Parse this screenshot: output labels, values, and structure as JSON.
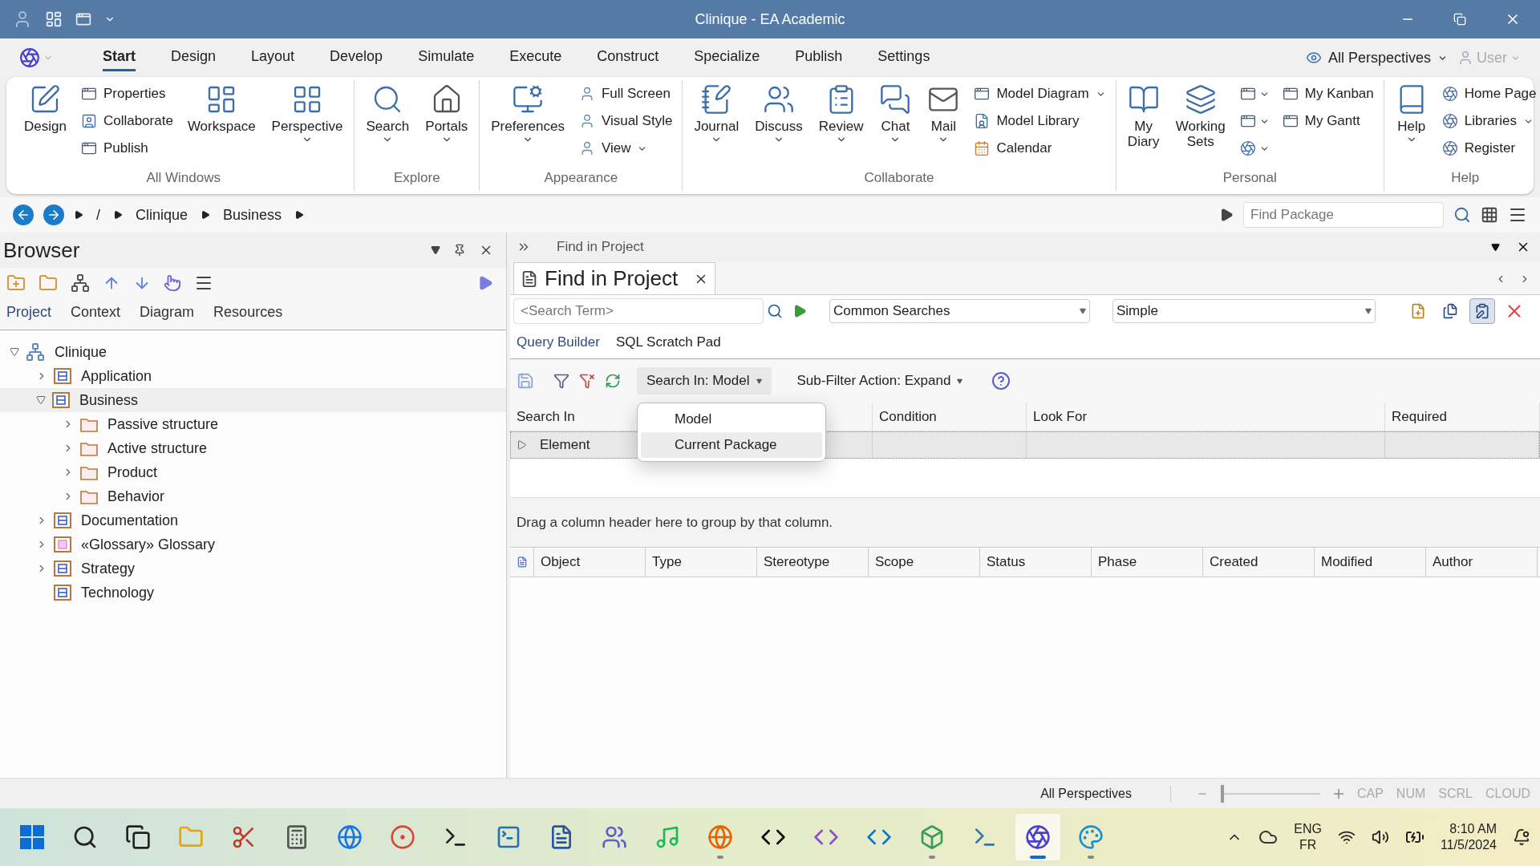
{
  "window": {
    "title": "Clinique - EA Academic"
  },
  "menu_tabs": [
    {
      "label": "Start",
      "selected": true
    },
    {
      "label": "Design",
      "selected": false
    },
    {
      "label": "Layout",
      "selected": false
    },
    {
      "label": "Develop",
      "selected": false
    },
    {
      "label": "Simulate",
      "selected": false
    },
    {
      "label": "Execute",
      "selected": false
    },
    {
      "label": "Construct",
      "selected": false
    },
    {
      "label": "Specialize",
      "selected": false
    },
    {
      "label": "Publish",
      "selected": false
    },
    {
      "label": "Settings",
      "selected": false
    }
  ],
  "perspective_menu": "All Perspectives",
  "user_menu": "User",
  "ribbon": [
    {
      "label": "All Windows",
      "items": [
        {
          "kind": "large",
          "label": "Design",
          "dropdown": false
        },
        {
          "kind": "small",
          "label": "Properties",
          "dropdown": false
        },
        {
          "kind": "small",
          "label": "Collaborate",
          "dropdown": false
        },
        {
          "kind": "small",
          "label": "Publish",
          "dropdown": false
        },
        {
          "kind": "large",
          "label": "Workspace",
          "dropdown": false
        },
        {
          "kind": "large",
          "label": "Perspective",
          "dropdown": true
        }
      ]
    },
    {
      "label": "Explore",
      "items": [
        {
          "kind": "large",
          "label": "Search",
          "dropdown": true
        },
        {
          "kind": "large",
          "label": "Portals",
          "dropdown": true
        }
      ]
    },
    {
      "label": "Appearance",
      "items": [
        {
          "kind": "large",
          "label": "Preferences",
          "dropdown": true
        },
        {
          "kind": "small",
          "label": "Full Screen",
          "dropdown": false
        },
        {
          "kind": "small",
          "label": "Visual Style",
          "dropdown": false
        },
        {
          "kind": "small",
          "label": "View",
          "dropdown": true
        }
      ]
    },
    {
      "label": "Collaborate",
      "items": [
        {
          "kind": "large",
          "label": "Journal",
          "dropdown": true
        },
        {
          "kind": "large",
          "label": "Discuss",
          "dropdown": true
        },
        {
          "kind": "large",
          "label": "Review",
          "dropdown": true
        },
        {
          "kind": "large",
          "label": "Chat",
          "dropdown": true
        },
        {
          "kind": "large",
          "label": "Mail",
          "dropdown": true
        },
        {
          "kind": "small",
          "label": "Model Diagram",
          "dropdown": true
        },
        {
          "kind": "small",
          "label": "Model Library",
          "dropdown": false
        },
        {
          "kind": "small",
          "label": "Calendar",
          "dropdown": false
        }
      ]
    },
    {
      "label": "Personal",
      "items": [
        {
          "kind": "large",
          "label": "My Diary",
          "dropdown": false
        },
        {
          "kind": "large",
          "label": "Working Sets",
          "dropdown": false
        },
        {
          "kind": "icon",
          "dropdown": true
        },
        {
          "kind": "icon",
          "dropdown": true
        },
        {
          "kind": "icon",
          "dropdown": true
        },
        {
          "kind": "small",
          "label": "My Kanban",
          "dropdown": false
        },
        {
          "kind": "small",
          "label": "My Gantt",
          "dropdown": false
        }
      ]
    },
    {
      "label": "Help",
      "items": [
        {
          "kind": "large",
          "label": "Help",
          "dropdown": true
        },
        {
          "kind": "small",
          "label": "Home Page",
          "dropdown": false
        },
        {
          "kind": "small",
          "label": "Libraries",
          "dropdown": true
        },
        {
          "kind": "small",
          "label": "Register",
          "dropdown": false
        }
      ]
    }
  ],
  "breadcrumb": [
    "/",
    "Clinique",
    "Business"
  ],
  "find_package": {
    "placeholder": "Find Package"
  },
  "browser": {
    "title": "Browser",
    "tabs": [
      {
        "label": "Project",
        "selected": true
      },
      {
        "label": "Context",
        "selected": false
      },
      {
        "label": "Diagram",
        "selected": false
      },
      {
        "label": "Resources",
        "selected": false
      }
    ],
    "tree": [
      {
        "label": "Clinique",
        "kind": "model",
        "expandable": true,
        "expanded": true,
        "selected": false,
        "children": [
          {
            "label": "Application",
            "kind": "package",
            "expandable": true,
            "expanded": false,
            "selected": false
          },
          {
            "label": "Business",
            "kind": "package",
            "expandable": true,
            "expanded": true,
            "selected": true,
            "children": [
              {
                "label": "Passive structure",
                "kind": "folder",
                "expandable": true,
                "expanded": false,
                "selected": false
              },
              {
                "label": "Active structure",
                "kind": "folder",
                "expandable": true,
                "expanded": false,
                "selected": false
              },
              {
                "label": "Product",
                "kind": "folder",
                "expandable": true,
                "expanded": false,
                "selected": false
              },
              {
                "label": "Behavior",
                "kind": "folder",
                "expandable": true,
                "expanded": false,
                "selected": false
              }
            ]
          },
          {
            "label": "Documentation",
            "kind": "package",
            "expandable": true,
            "expanded": false,
            "selected": false
          },
          {
            "label": "«Glossary» Glossary",
            "kind": "glossary",
            "expandable": true,
            "expanded": false,
            "selected": false
          },
          {
            "label": "Strategy",
            "kind": "package",
            "expandable": true,
            "expanded": false,
            "selected": false
          },
          {
            "label": "Technology",
            "kind": "package",
            "expandable": false,
            "expanded": false,
            "selected": false
          }
        ]
      }
    ]
  },
  "find": {
    "panel_title": "Find in Project",
    "tab_title": "Find in Project",
    "search": {
      "placeholder": "<Search Term>"
    },
    "combos": [
      "Common Searches",
      "Simple"
    ],
    "tool_buttons": [
      {
        "pressed": false
      },
      {
        "pressed": false
      },
      {
        "pressed": true
      },
      {
        "pressed": false
      }
    ],
    "subtabs": [
      {
        "label": "Query Builder",
        "selected": true
      },
      {
        "label": "SQL Scratch Pad",
        "selected": false
      }
    ],
    "search_in_button": "Search In: Model",
    "subfilter_button": "Sub-Filter Action: Expand",
    "search_in_menu": [
      {
        "label": "Model",
        "selected": false
      },
      {
        "label": "Current Package",
        "selected": true
      }
    ],
    "query_columns": [
      "Search In",
      "Condition",
      "Look For",
      "Required"
    ],
    "query_rows": [
      {
        "cells": [
          "Element",
          "",
          "",
          ""
        ]
      }
    ],
    "group_hint": "Drag a column header here to group by that column.",
    "result_columns": [
      "Object",
      "Type",
      "Stereotype",
      "Scope",
      "Status",
      "Phase",
      "Created",
      "Modified",
      "Author"
    ]
  },
  "status_bar": {
    "perspective": "All Perspectives",
    "zoom": {
      "level": 0.0
    },
    "indicators": [
      {
        "label": "CAP",
        "on": false
      },
      {
        "label": "NUM",
        "on": false
      },
      {
        "label": "SCRL",
        "on": false
      },
      {
        "label": "CLOUD",
        "on": false
      }
    ]
  },
  "taskbar": {
    "apps": [
      {
        "running": false,
        "selected": false
      },
      {
        "running": false,
        "selected": false
      },
      {
        "running": false,
        "selected": false
      },
      {
        "running": false,
        "selected": false
      },
      {
        "running": false,
        "selected": false
      },
      {
        "running": false,
        "selected": false
      },
      {
        "running": false,
        "selected": false
      },
      {
        "running": false,
        "selected": false
      },
      {
        "running": false,
        "selected": false
      },
      {
        "running": false,
        "selected": false
      },
      {
        "running": false,
        "selected": false
      },
      {
        "running": false,
        "selected": false
      },
      {
        "running": false,
        "selected": false
      },
      {
        "running": true,
        "selected": false
      },
      {
        "running": false,
        "selected": false
      },
      {
        "running": false,
        "selected": false
      },
      {
        "running": false,
        "selected": false
      },
      {
        "running": true,
        "selected": false
      },
      {
        "running": false,
        "selected": false
      },
      {
        "running": true,
        "selected": true
      },
      {
        "running": true,
        "selected": false
      }
    ],
    "language": "ENG",
    "layout": "FR",
    "time": "8:10 AM",
    "date": "11/5/2024"
  }
}
